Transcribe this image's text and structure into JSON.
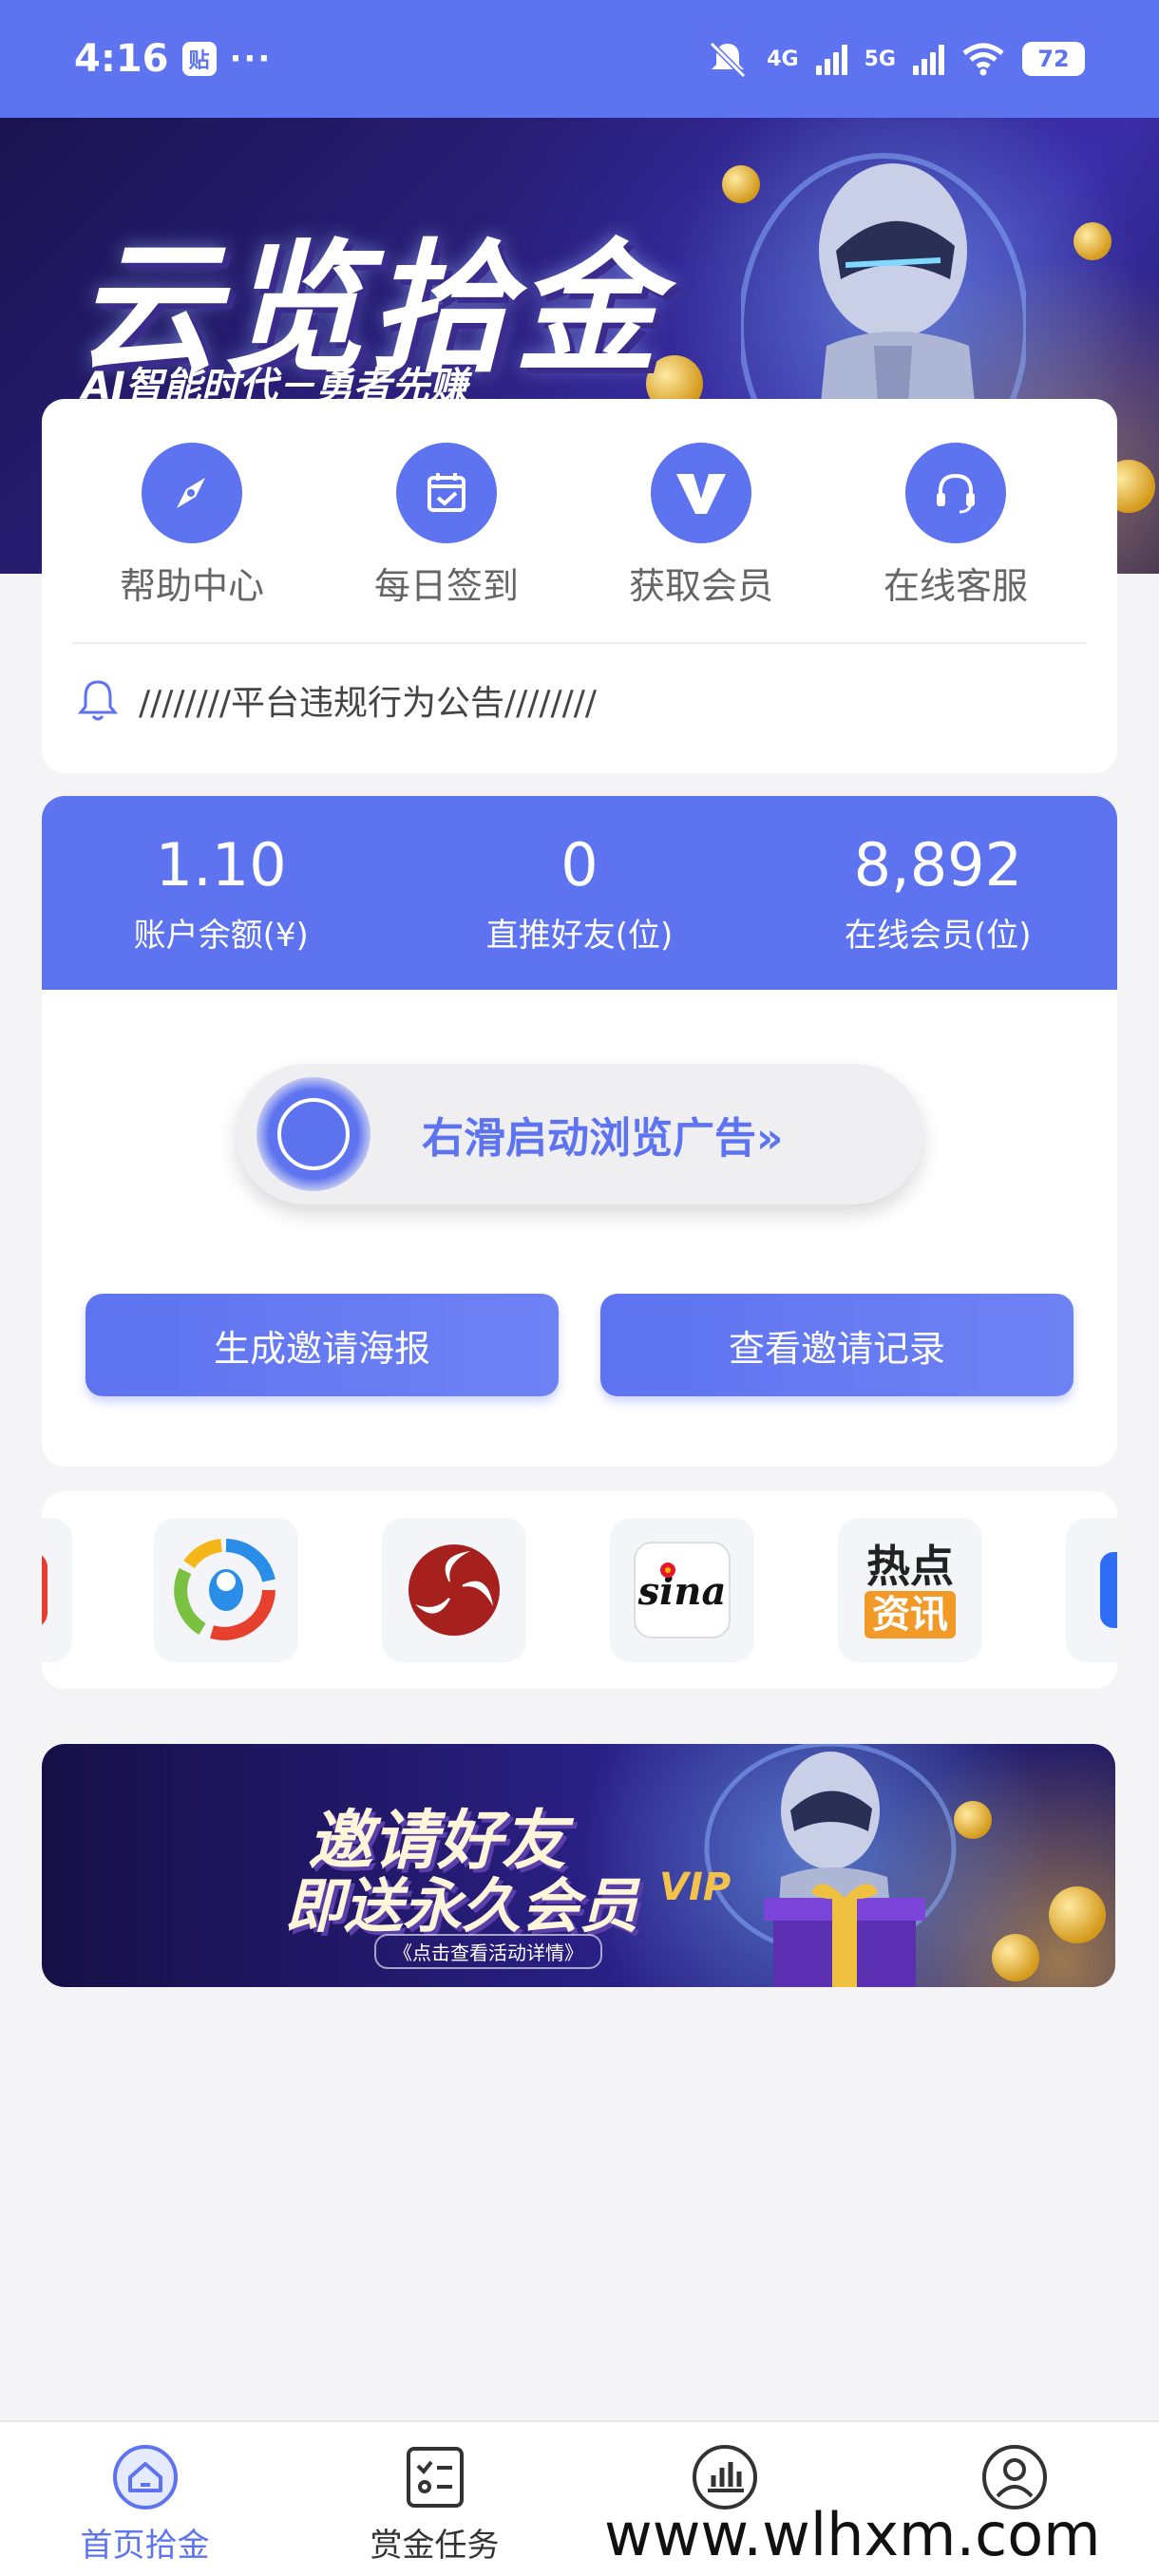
{
  "status_bar": {
    "time": "4:16",
    "app_badge": "贴",
    "more": "···",
    "network_1": "4G",
    "network_2": "5G",
    "battery": "72"
  },
  "banner": {
    "title": "云览拾金",
    "subtitle": "AI智能时代－勇者先赚"
  },
  "quick_menu": {
    "items": [
      {
        "label": "帮助中心",
        "icon": "compass-icon"
      },
      {
        "label": "每日签到",
        "icon": "calendar-check-icon"
      },
      {
        "label": "获取会员",
        "icon": "vip-icon"
      },
      {
        "label": "在线客服",
        "icon": "headset-icon"
      }
    ],
    "notice": "////////平台违规行为公告////////"
  },
  "stats": [
    {
      "value": "1.10",
      "label": "账户余额(¥)"
    },
    {
      "value": "0",
      "label": "直推好友(位)"
    },
    {
      "value": "8,892",
      "label": "在线会员(位)"
    }
  ],
  "slider": {
    "text": "右滑启动浏览广告»"
  },
  "buttons": {
    "poster": "生成邀请海报",
    "records": "查看邀请记录"
  },
  "news_apps": [
    {
      "name": "tencent-news"
    },
    {
      "name": "ifeng"
    },
    {
      "name": "sina"
    },
    {
      "name": "hot-news",
      "line1": "热点",
      "line2": "资讯"
    }
  ],
  "invite_banner": {
    "title_line1": "邀请好友",
    "title_line2": "即送永久会员",
    "sub": "《点击查看活动详情》",
    "vip": "VIP"
  },
  "bottom_nav": [
    {
      "label": "首页拾金",
      "active": true
    },
    {
      "label": "赏金任务",
      "active": false
    },
    {
      "label": "",
      "active": false
    },
    {
      "label": "",
      "active": false
    }
  ],
  "watermark": "www.wlhxm.com",
  "colors": {
    "accent": "#5d73f0"
  }
}
